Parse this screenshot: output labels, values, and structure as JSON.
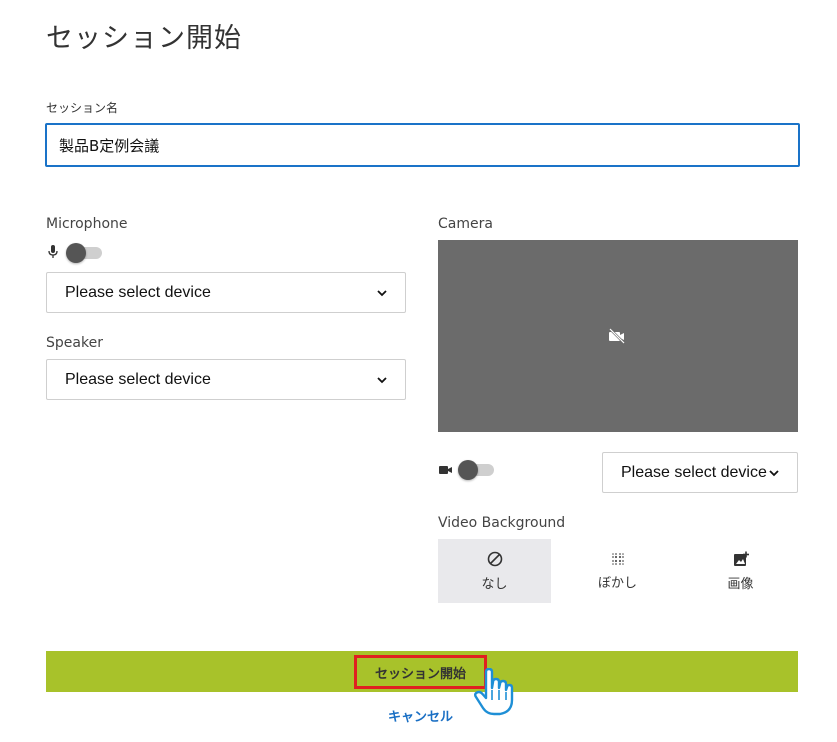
{
  "page": {
    "title": "セッション開始"
  },
  "session_name": {
    "label": "セッション名",
    "value": "製品B定例会議"
  },
  "microphone": {
    "label": "Microphone",
    "icon": "microphone-icon",
    "enabled": false,
    "device": "Please select device"
  },
  "speaker": {
    "label": "Speaker",
    "device": "Please select device"
  },
  "camera": {
    "label": "Camera",
    "icon": "video-camera-icon",
    "enabled": false,
    "device": "Please select device",
    "preview_icon": "camera-off-icon"
  },
  "video_background": {
    "label": "Video Background",
    "options": [
      {
        "label": "なし",
        "icon": "none-icon",
        "selected": true
      },
      {
        "label": "ぼかし",
        "icon": "blur-icon",
        "selected": false
      },
      {
        "label": "画像",
        "icon": "add-image-icon",
        "selected": false
      }
    ]
  },
  "actions": {
    "start_label": "セッション開始",
    "cancel_label": "キャンセル",
    "accent_color": "#a8c22a",
    "highlight_color": "#e02020",
    "link_color": "#1a6fc4"
  }
}
